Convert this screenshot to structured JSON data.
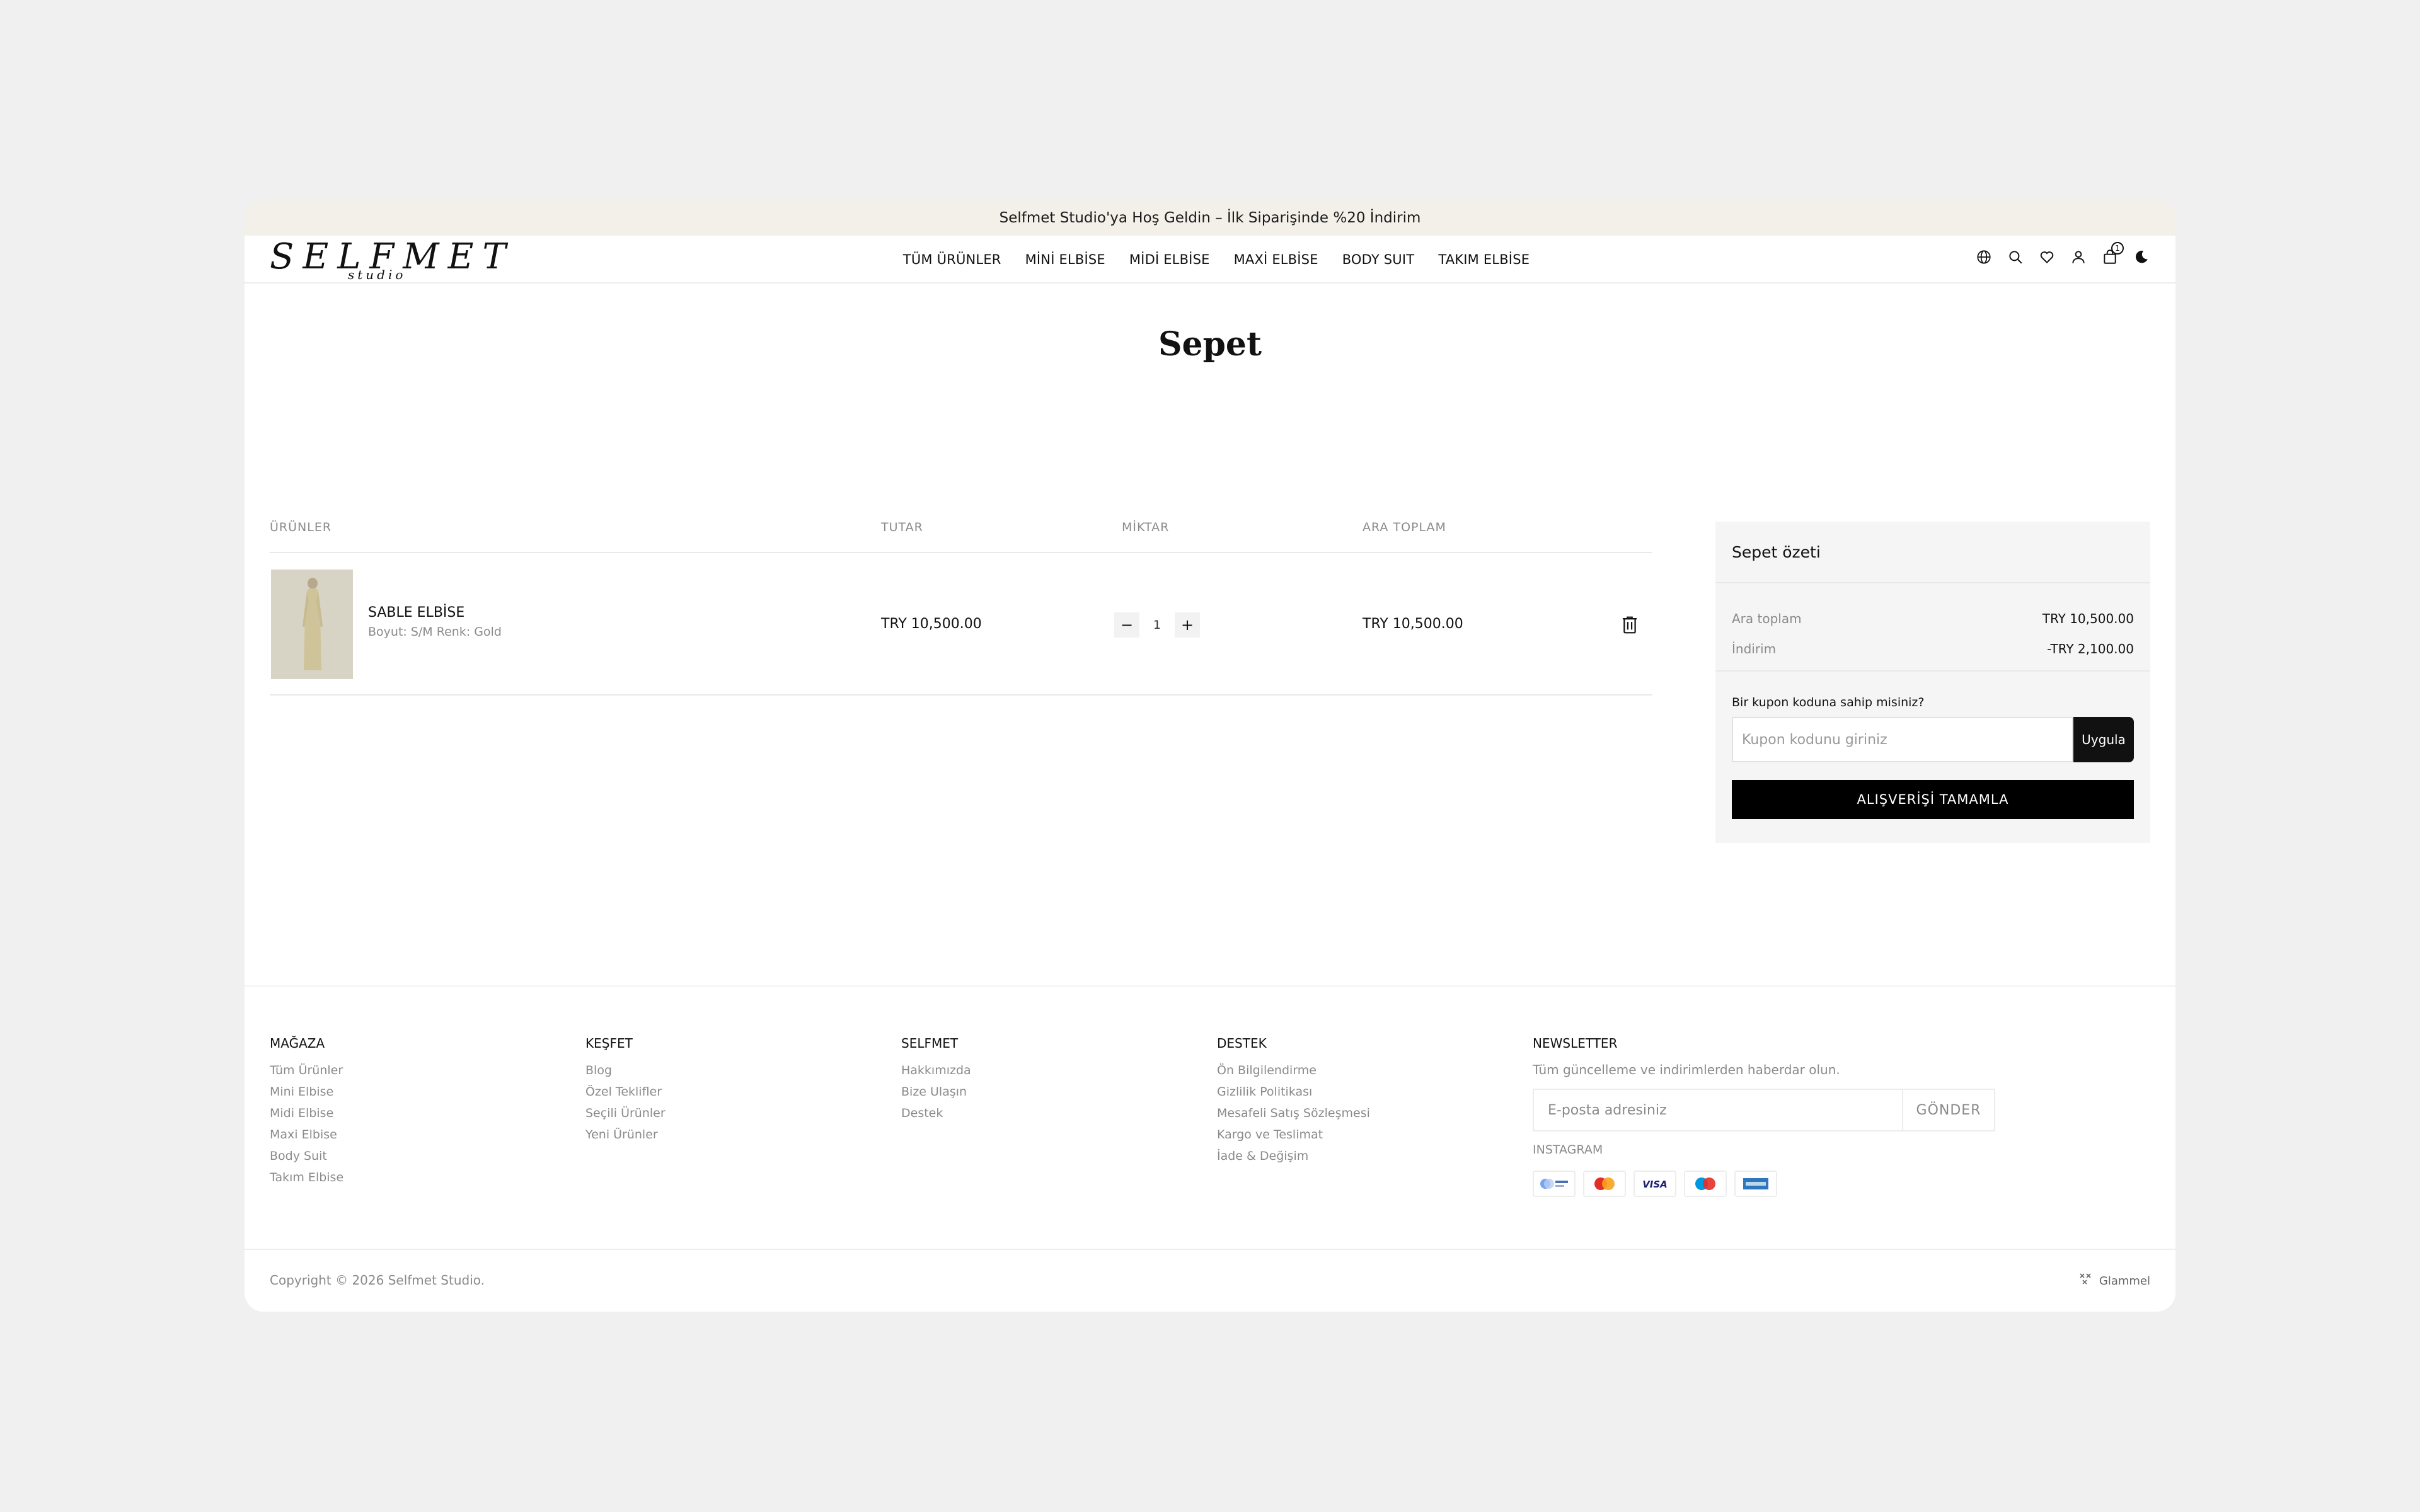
{
  "announcement": "Selfmet Studio'ya Hoş Geldin – İlk Siparişinde %20 İndirim",
  "logo": {
    "word": "SELFMET",
    "sub": "studio"
  },
  "nav": [
    "TÜM ÜRÜNLER",
    "MİNİ ELBİSE",
    "MİDİ ELBİSE",
    "MAXİ ELBİSE",
    "BODY SUIT",
    "TAKIM ELBİSE"
  ],
  "header_icons": [
    "globe-icon",
    "search-icon",
    "heart-icon",
    "user-icon",
    "bag-icon",
    "moon-icon"
  ],
  "cart_count": "1",
  "page_title": "Sepet",
  "table": {
    "headers": [
      "ÜRÜNLER",
      "TUTAR",
      "MİKTAR",
      "ARA TOPLAM"
    ],
    "items": [
      {
        "name": "SABLE ELBİSE",
        "meta": "Boyut: S/M Renk: Gold",
        "price": "TRY 10,500.00",
        "qty": "1",
        "subtotal": "TRY 10,500.00"
      }
    ]
  },
  "summary": {
    "title": "Sepet özeti",
    "subtotal_label": "Ara toplam",
    "subtotal_value": "TRY 10,500.00",
    "discount_label": "İndirim",
    "discount_value": "-TRY 2,100.00",
    "coupon_label": "Bir kupon koduna sahip misiniz?",
    "coupon_placeholder": "Kupon kodunu giriniz",
    "coupon_button": "Uygula",
    "checkout_button": "ALIŞVERİŞİ TAMAMLA"
  },
  "footer": {
    "columns": [
      {
        "title": "MAĞAZA",
        "links": [
          "Tüm Ürünler",
          "Mini Elbise",
          "Midi Elbise",
          "Maxi Elbise",
          "Body Suit",
          "Takım Elbise"
        ]
      },
      {
        "title": "KEŞFET",
        "links": [
          "Blog",
          "Özel Teklifler",
          "Seçili Ürünler",
          "Yeni Ürünler"
        ]
      },
      {
        "title": "SELFMET",
        "links": [
          "Hakkımızda",
          "Bize Ulaşın",
          "Destek"
        ]
      },
      {
        "title": "DESTEK",
        "links": [
          "Ön Bilgilendirme",
          "Gizlilik Politikası",
          "Mesafeli Satış Sözleşmesi",
          "Kargo ve Teslimat",
          "İade & Değişim"
        ]
      }
    ],
    "newsletter_title": "NEWSLETTER",
    "newsletter_desc": "Tüm güncelleme ve indirimlerden haberdar olun.",
    "newsletter_placeholder": "E-posta adresiniz",
    "newsletter_button": "GÖNDER",
    "instagram": "INSTAGRAM",
    "payments": [
      "iyzico-icon",
      "mastercard-icon",
      "visa-icon",
      "maestro-icon",
      "amex-icon"
    ],
    "copyright": "Copyright © 2026 Selfmet Studio.",
    "credit": "Glammel"
  }
}
